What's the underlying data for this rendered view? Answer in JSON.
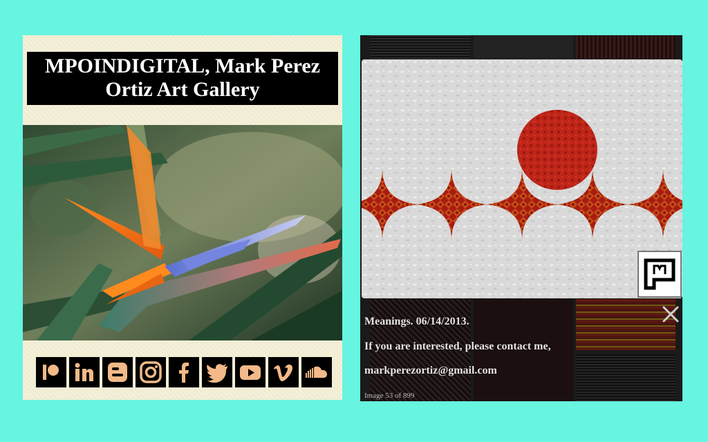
{
  "gallery": {
    "title_line1": "MPOINDIGITAL, Mark Perez",
    "title_line2": "Ortiz Art Gallery",
    "photo_icon": "bird-of-paradise-flower-photo",
    "social_links": [
      {
        "name": "patreon-icon"
      },
      {
        "name": "linkedin-icon"
      },
      {
        "name": "blogger-icon"
      },
      {
        "name": "instagram-icon"
      },
      {
        "name": "facebook-icon"
      },
      {
        "name": "twitter-icon"
      },
      {
        "name": "youtube-icon"
      },
      {
        "name": "vimeo-icon"
      },
      {
        "name": "soundcloud-icon"
      }
    ],
    "social_icon_color": "#f3b988"
  },
  "lightbox": {
    "caption_title": "Meanings. 06/14/2013.",
    "caption_line2": "If you are interested, please contact me,",
    "caption_email": "markperezortiz@gmail.com",
    "counter": "Image 53 of 899",
    "close_icon": "close-icon",
    "logo_icon": "mp-logo-icon"
  },
  "colors": {
    "page_background": "#67f4e0",
    "panel_background": "#f5f0d8",
    "art_red": "#c0251a"
  }
}
